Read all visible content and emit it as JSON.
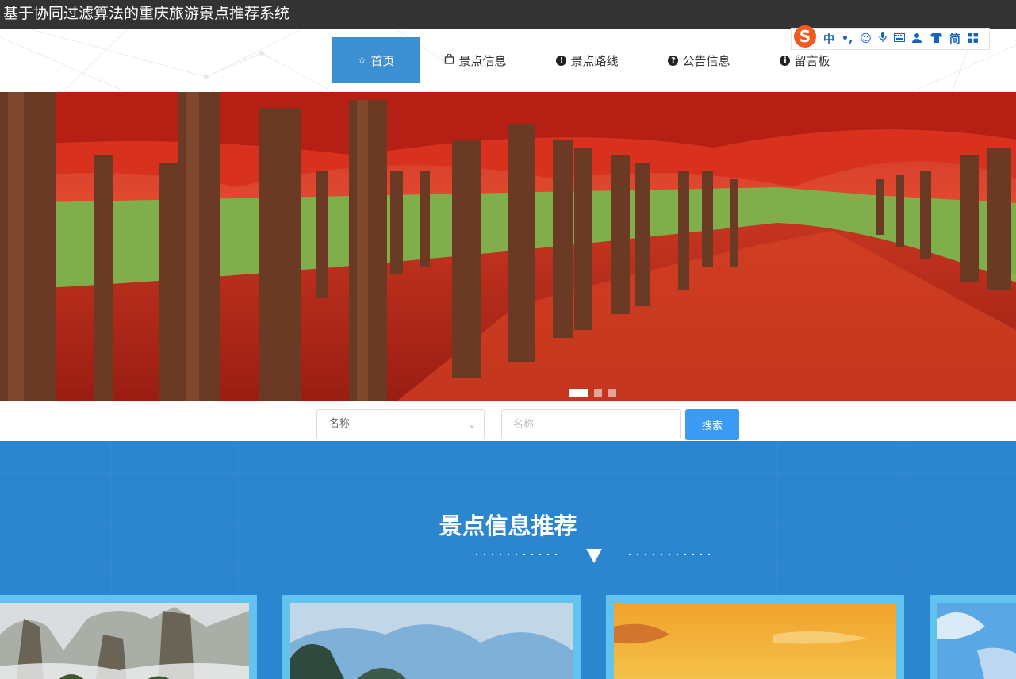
{
  "app": {
    "title": "基于协同过滤算法的重庆旅游景点推荐系统"
  },
  "nav": {
    "items": [
      {
        "label": "首页",
        "icon": "star-outline-icon",
        "active": true
      },
      {
        "label": "景点信息",
        "icon": "bag-icon",
        "active": false
      },
      {
        "label": "景点路线",
        "icon": "exclamation-circle-icon",
        "active": false
      },
      {
        "label": "公告信息",
        "icon": "question-circle-icon",
        "active": false
      },
      {
        "label": "留言板",
        "icon": "info-circle-icon",
        "active": false
      }
    ]
  },
  "ime": {
    "logo": "S",
    "items": [
      "中",
      "•,",
      "☺",
      "🎤",
      "⌨",
      "👤",
      "👕",
      "简",
      "▦"
    ],
    "icons": [
      "sogou-logo-icon",
      "chinese-mode-icon",
      "punctuation-icon",
      "emoji-icon",
      "microphone-icon",
      "keyboard-icon",
      "account-icon",
      "skin-icon",
      "simplified-icon",
      "toolbox-icon"
    ]
  },
  "banner": {
    "slides": 3,
    "active_slide": 1
  },
  "search": {
    "field_select": "名称",
    "input_placeholder": "名称",
    "input_value": "",
    "button_label": "搜索"
  },
  "recommend": {
    "title": "景点信息推荐",
    "cards": [
      {
        "image": "karst-peaks-mist"
      },
      {
        "image": "karst-mountain-sky"
      },
      {
        "image": "sunset-sky"
      },
      {
        "image": "blue-sky"
      }
    ]
  },
  "colors": {
    "titlebar": "#333333",
    "nav_active": "#3c8fd0",
    "search_button": "#3a9af4",
    "section_bg": "#2b86cf",
    "card_border": "#63c3ef"
  }
}
